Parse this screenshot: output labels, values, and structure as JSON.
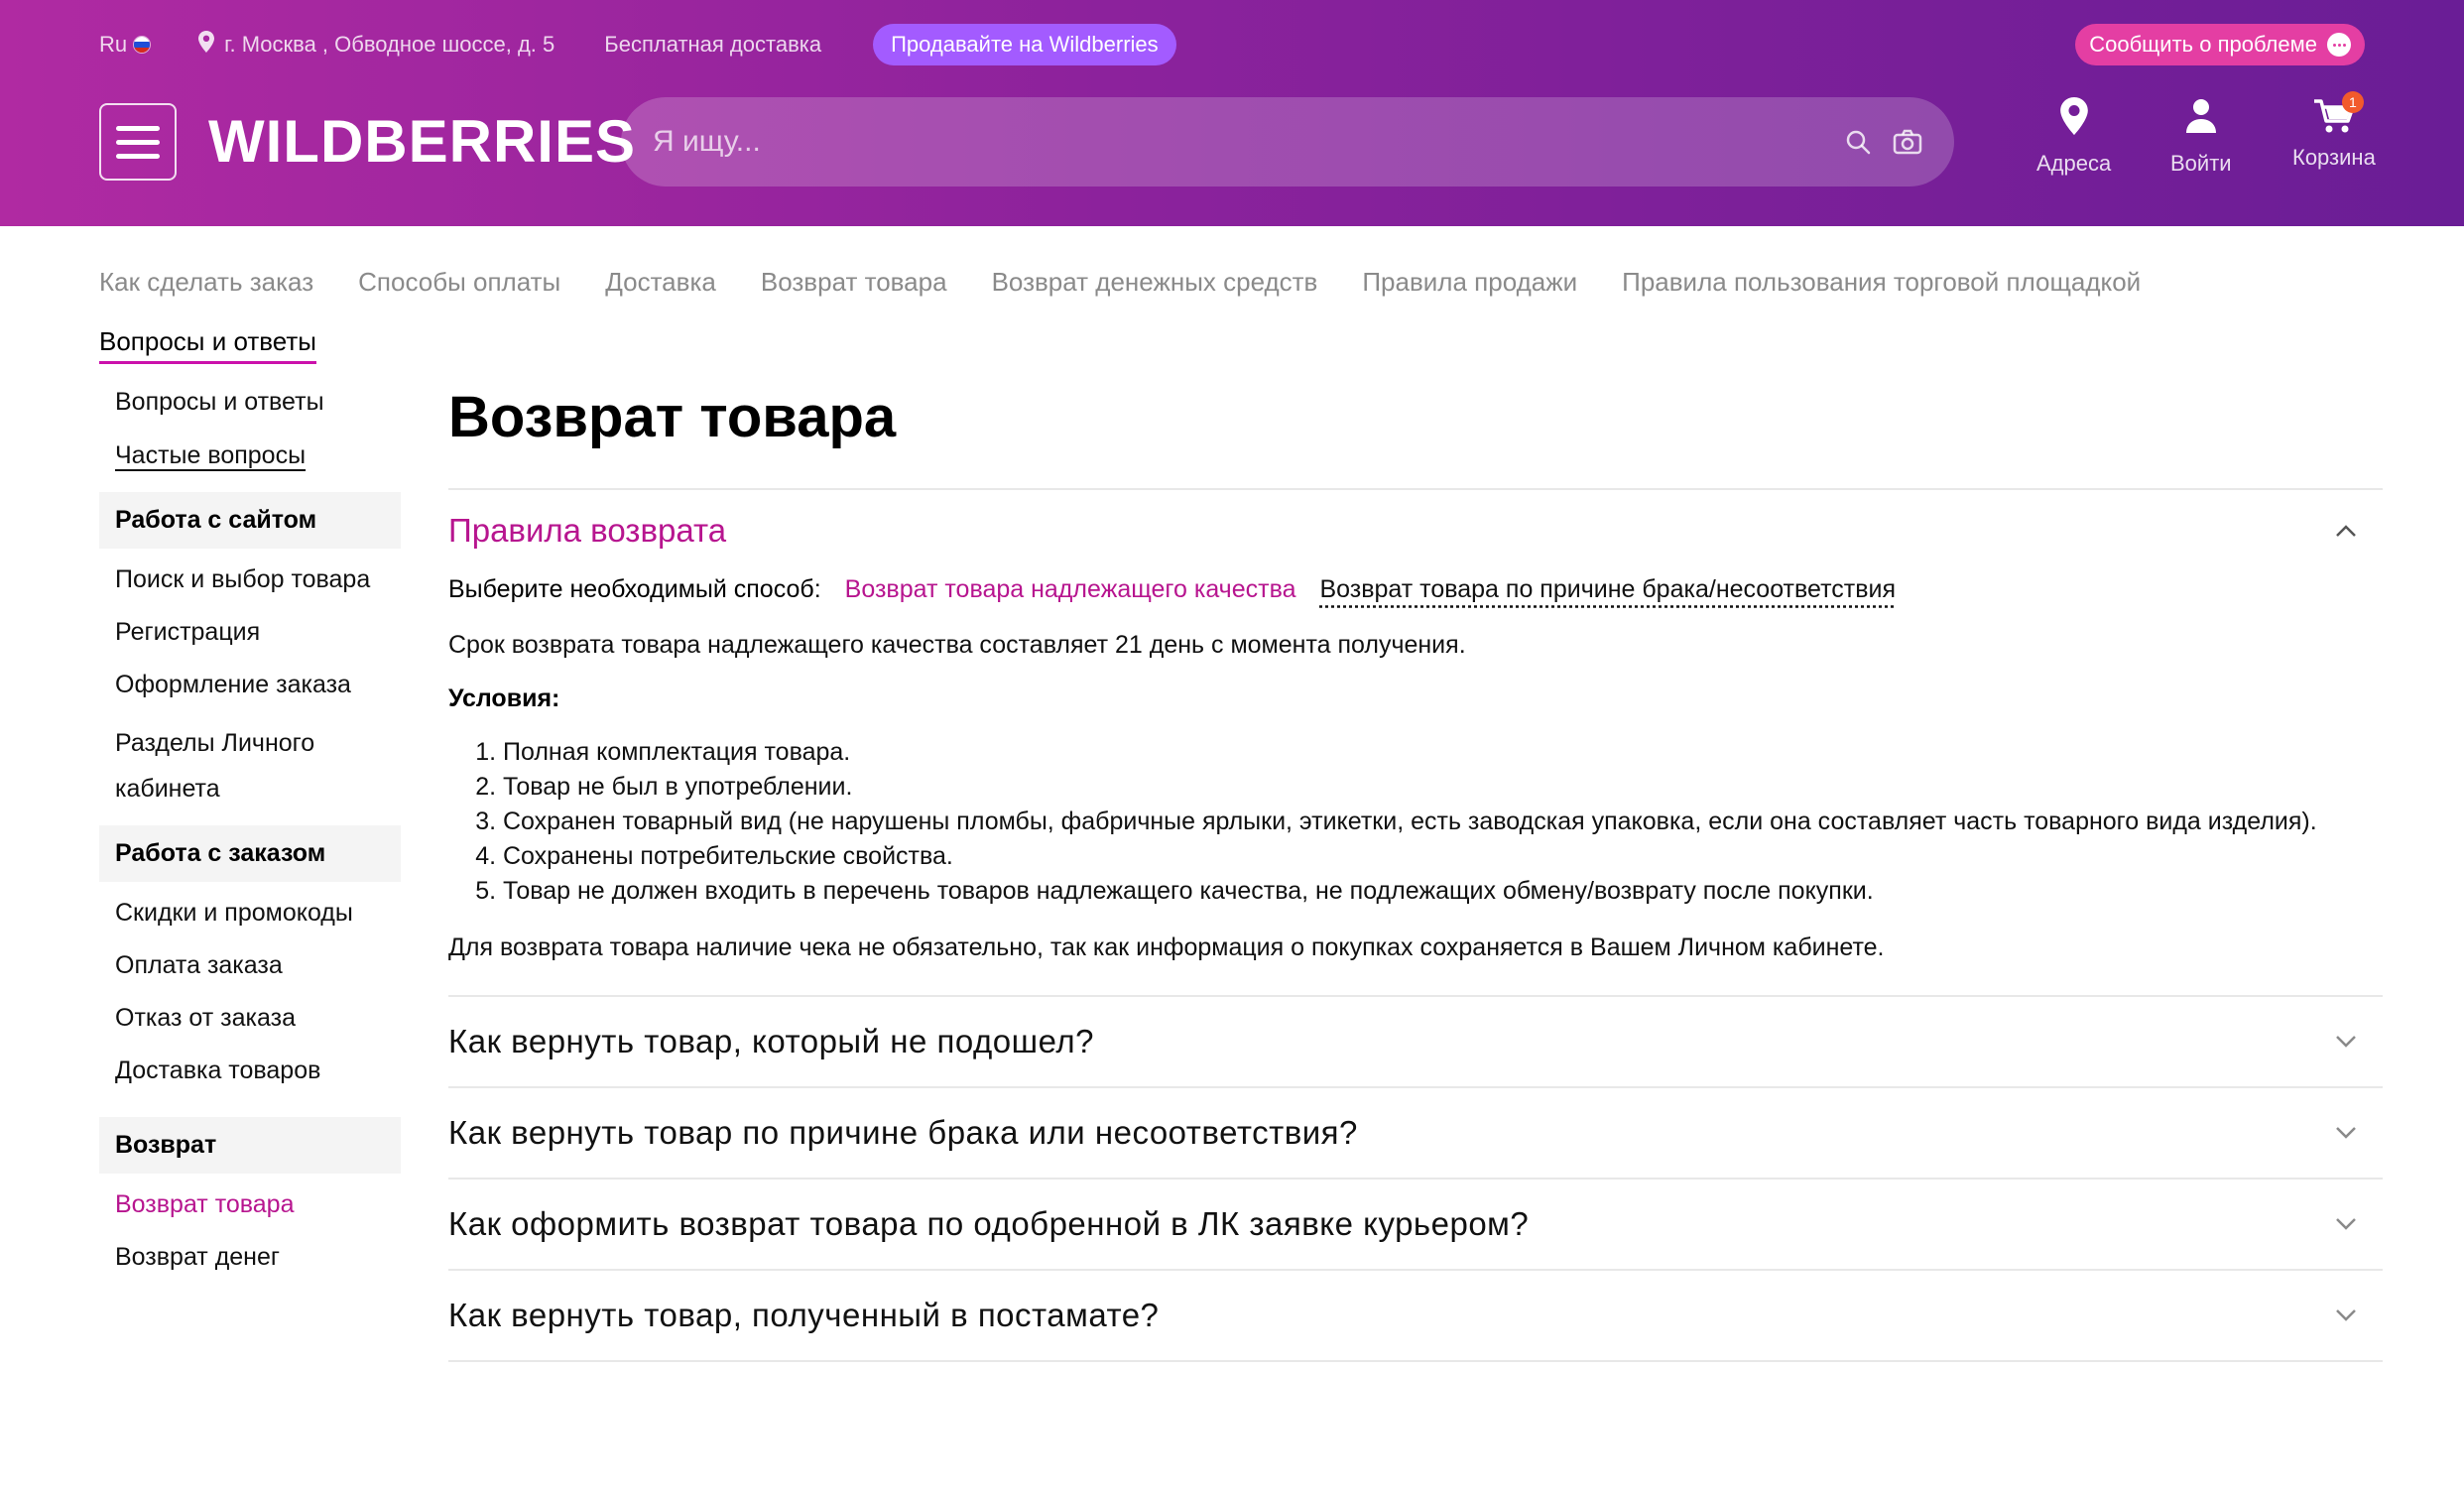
{
  "colors": {
    "header_start": "#b02aa2",
    "header_end": "#6a1d96",
    "accent": "#b7158f",
    "tab_underline": "#cb11ab",
    "sell_button": "#a35bff",
    "report_button": "#e43ea3",
    "badge": "#f25a2c"
  },
  "topbar": {
    "lang": "Ru",
    "flag_icon": "russia-flag-icon",
    "address": "г. Москва , Обводное шоссе, д. 5",
    "address_icon": "location-pin-icon",
    "free_delivery": "Бесплатная доставка",
    "sell_button": "Продавайте на Wildberries",
    "report_button": "Сообщить о проблеме",
    "report_icon": "chat-bubble-icon"
  },
  "header": {
    "menu_icon": "hamburger-menu-icon",
    "logo": "WILDBERRIES",
    "search_placeholder": "Я ищу...",
    "search_icon": "search-icon",
    "camera_icon": "camera-icon",
    "nav": [
      {
        "label": "Адреса",
        "icon": "location-pin-icon"
      },
      {
        "label": "Войти",
        "icon": "user-icon"
      },
      {
        "label": "Корзина",
        "icon": "cart-icon",
        "badge": "1"
      }
    ]
  },
  "tabs": [
    {
      "label": "Как сделать заказ"
    },
    {
      "label": "Способы оплаты"
    },
    {
      "label": "Доставка"
    },
    {
      "label": "Возврат товара"
    },
    {
      "label": "Возврат денежных средств"
    },
    {
      "label": "Правила продажи"
    },
    {
      "label": "Правила пользования торговой площадкой"
    },
    {
      "label": "Вопросы и ответы",
      "active": true
    }
  ],
  "sidebar": {
    "top_links": [
      "Вопросы и ответы",
      "Частые вопросы"
    ],
    "groups": [
      {
        "title": "Работа с сайтом",
        "items": [
          "Поиск и выбор товара",
          "Регистрация",
          "Оформление заказа",
          "Разделы Личного кабинета"
        ]
      },
      {
        "title": "Работа с заказом",
        "items": [
          "Скидки и промокоды",
          "Оплата заказа",
          "Отказ от заказа",
          "Доставка товаров"
        ]
      },
      {
        "title": "Возврат",
        "items": [
          "Возврат товара",
          "Возврат денег"
        ]
      }
    ]
  },
  "main": {
    "title": "Возврат товара",
    "open_section": {
      "title": "Правила возврата",
      "choose_label": "Выберите необходимый способ:",
      "option_active": "Возврат товара надлежащего качества",
      "option_other": "Возврат товара по причине брака/несоответствия",
      "term_text": "Срок возврата товара надлежащего качества составляет 21 день с момента получения.",
      "conditions_label": "Условия:",
      "conditions": [
        "Полная комплектация товара.",
        "Товар не был в употреблении.",
        "Сохранен товарный вид (не нарушены пломбы, фабричные ярлыки, этикетки, есть заводская упаковка, если она составляет часть товарного вида изделия).",
        "Сохранены потребительские свойства.",
        "Товар не должен входить в перечень товаров надлежащего качества, не подлежащих обмену/возврату после покупки."
      ],
      "receipt_text": "Для возврата товара наличие чека не обязательно, так как информация о покупках сохраняется в Вашем Личном кабинете."
    },
    "accordion": [
      "Как вернуть товар, который не подошел?",
      "Как вернуть товар по причине брака или несоответствия?",
      "Как оформить возврат товара по одобренной в ЛК заявке курьером?",
      "Как вернуть товар, полученный в постамате?"
    ]
  }
}
